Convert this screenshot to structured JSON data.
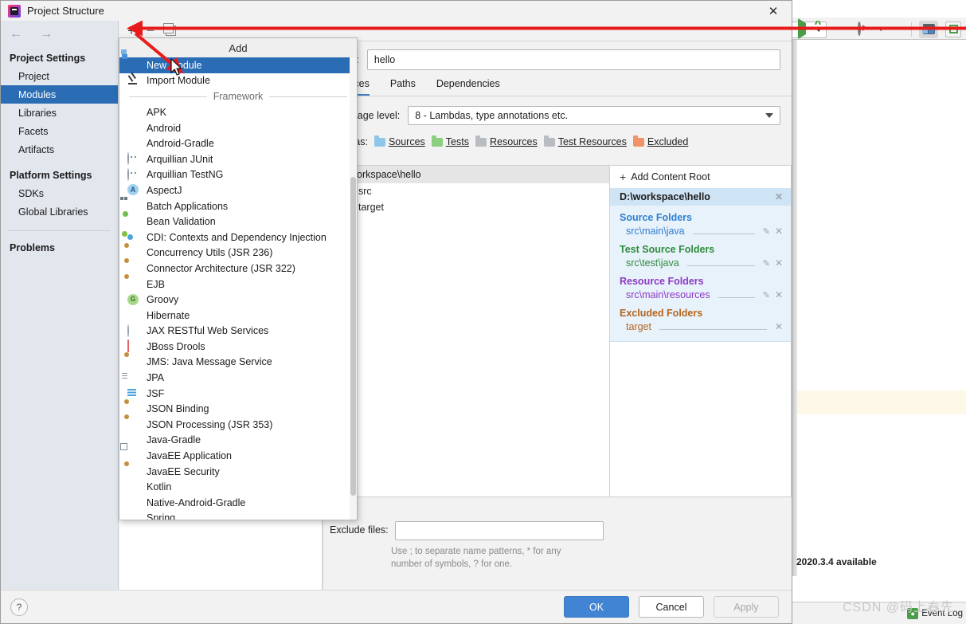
{
  "dialog": {
    "title": "Project Structure",
    "close_label": "✕",
    "help_label": "?"
  },
  "nav": {
    "back_icon": "←",
    "forward_icon": "→",
    "groups": [
      {
        "title": "Project Settings",
        "items": [
          {
            "label": "Project",
            "selected": false
          },
          {
            "label": "Modules",
            "selected": true
          },
          {
            "label": "Libraries",
            "selected": false
          },
          {
            "label": "Facets",
            "selected": false
          },
          {
            "label": "Artifacts",
            "selected": false
          }
        ]
      },
      {
        "title": "Platform Settings",
        "items": [
          {
            "label": "SDKs",
            "selected": false
          },
          {
            "label": "Global Libraries",
            "selected": false
          }
        ]
      }
    ],
    "problems_label": "Problems"
  },
  "module_toolbar": {
    "add_label": "+",
    "remove_label": "−",
    "copy_label": "copy-icon"
  },
  "add_menu": {
    "title": "Add",
    "top_items": [
      {
        "label": "New Module",
        "icon": "module-icon",
        "selected": true
      },
      {
        "label": "Import Module",
        "icon": "import-icon",
        "selected": false
      }
    ],
    "section_label": "Framework",
    "framework_items": [
      {
        "label": "APK",
        "icon": "android-icon"
      },
      {
        "label": "Android",
        "icon": "android-icon"
      },
      {
        "label": "Android-Gradle",
        "icon": "android-icon"
      },
      {
        "label": "Arquillian JUnit",
        "icon": "arquillian-icon"
      },
      {
        "label": "Arquillian TestNG",
        "icon": "arquillian-icon"
      },
      {
        "label": "AspectJ",
        "icon": "aspectj-icon"
      },
      {
        "label": "Batch Applications",
        "icon": "batch-icon"
      },
      {
        "label": "Bean Validation",
        "icon": "bean-validation-icon"
      },
      {
        "label": "CDI: Contexts and Dependency Injection",
        "icon": "cdi-icon"
      },
      {
        "label": "Concurrency Utils (JSR 236)",
        "icon": "javaee-icon"
      },
      {
        "label": "Connector Architecture (JSR 322)",
        "icon": "javaee-icon"
      },
      {
        "label": "EJB",
        "icon": "javaee-icon"
      },
      {
        "label": "Groovy",
        "icon": "groovy-icon"
      },
      {
        "label": "Hibernate",
        "icon": "hibernate-icon"
      },
      {
        "label": "JAX RESTful Web Services",
        "icon": "jax-icon"
      },
      {
        "label": "JBoss Drools",
        "icon": "drools-icon"
      },
      {
        "label": "JMS: Java Message Service",
        "icon": "javaee-icon"
      },
      {
        "label": "JPA",
        "icon": "jpa-icon"
      },
      {
        "label": "JSF",
        "icon": "jsf-icon"
      },
      {
        "label": "JSON Binding",
        "icon": "javaee-icon"
      },
      {
        "label": "JSON Processing (JSR 353)",
        "icon": "javaee-icon"
      },
      {
        "label": "Java-Gradle",
        "icon": "none"
      },
      {
        "label": "JavaEE Application",
        "icon": "javaee-app-icon"
      },
      {
        "label": "JavaEE Security",
        "icon": "javaee-icon"
      },
      {
        "label": "Kotlin",
        "icon": "kotlin-icon"
      },
      {
        "label": "Native-Android-Gradle",
        "icon": "android-icon"
      },
      {
        "label": "Spring",
        "icon": "spring-icon"
      }
    ]
  },
  "content": {
    "name_label": "Name:",
    "name_value": "hello",
    "tabs": [
      {
        "label": "Sources",
        "active": true
      },
      {
        "label": "Paths",
        "active": false
      },
      {
        "label": "Dependencies",
        "active": false
      }
    ],
    "language_level_label": "Language level:",
    "language_level_value": "8 - Lambdas, type annotations etc.",
    "mark_as_label": "Mark as:",
    "marks": [
      {
        "label": "Sources",
        "color": "#8fc6e8"
      },
      {
        "label": "Tests",
        "color": "#8ccf7e"
      },
      {
        "label": "Resources",
        "color": "#b9bcc0"
      },
      {
        "label": "Test Resources",
        "color": "#b9bcc0"
      },
      {
        "label": "Excluded",
        "color": "#f0936a"
      }
    ],
    "tree": {
      "root": "D:\\workspace\\hello",
      "children": [
        {
          "label": "src",
          "color": "#b9bcc0"
        },
        {
          "label": "target",
          "color": "#f0936a"
        }
      ]
    },
    "content_roots": {
      "add_label": "Add Content Root",
      "root_path": "D:\\workspace\\hello",
      "groups": [
        {
          "title": "Source Folders",
          "color": "#2f7fcf",
          "entries": [
            {
              "value": "src\\main\\java",
              "editable": true
            }
          ]
        },
        {
          "title": "Test Source Folders",
          "color": "#2e8b3c",
          "entries": [
            {
              "value": "src\\test\\java",
              "editable": true
            }
          ]
        },
        {
          "title": "Resource Folders",
          "color": "#8b39c4",
          "entries": [
            {
              "value": "src\\main\\resources",
              "editable": true
            }
          ]
        },
        {
          "title": "Excluded Folders",
          "color": "#b5651d",
          "entries": [
            {
              "value": "target",
              "editable": false
            }
          ]
        }
      ]
    },
    "exclude_files_label": "Exclude files:",
    "exclude_files_value": "",
    "exclude_hint_line1": "Use ; to separate name patterns, * for any",
    "exclude_hint_line2": "number of symbols, ? for one."
  },
  "footer": {
    "ok_label": "OK",
    "cancel_label": "Cancel",
    "apply_label": "Apply"
  },
  "ide": {
    "notification": "2020.3.4 available",
    "event_log_label": "Event Log",
    "watermark": "CSDN @码上春先"
  },
  "colors": {
    "selection_blue": "#2a6db5",
    "accent_blue": "#4184d3",
    "annotation_red": "#e81a1a",
    "content_root_bg": "#e8f2fb"
  }
}
